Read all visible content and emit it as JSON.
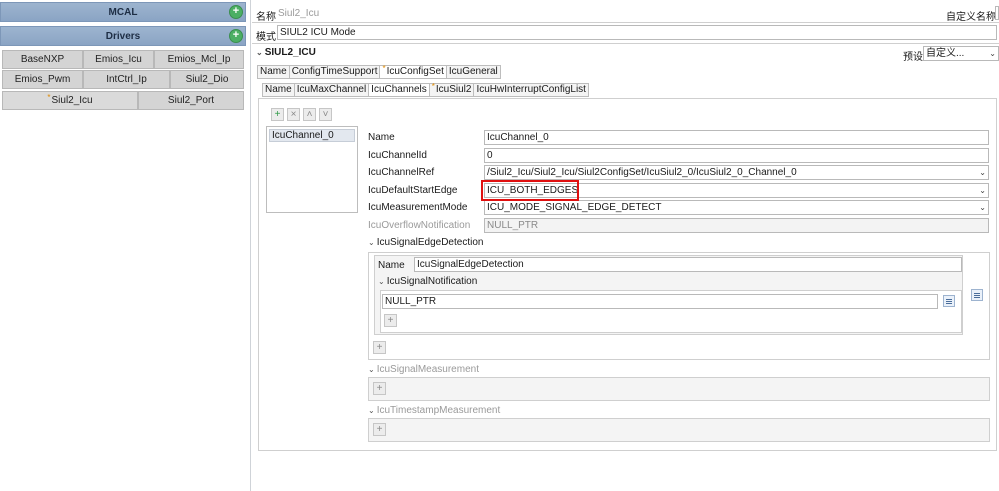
{
  "left": {
    "sections": [
      {
        "title": "MCAL"
      },
      {
        "title": "Drivers"
      }
    ],
    "drivers": [
      {
        "label": "BaseNXP"
      },
      {
        "label": "Emios_Icu"
      },
      {
        "label": "Emios_Mcl_Ip"
      },
      {
        "label": "Emios_Pwm"
      },
      {
        "label": "IntCtrl_Ip"
      },
      {
        "label": "Siul2_Dio"
      },
      {
        "label": "Siul2_Icu"
      },
      {
        "label": "Siul2_Port"
      }
    ]
  },
  "header": {
    "name_label": "名称",
    "name_value": "Siul2_Icu",
    "custom_name_label": "自定义名称",
    "mode_label": "模式",
    "mode_value": "SIUL2 ICU Mode",
    "section_title": "SIUL2_ICU",
    "preset_label": "预设",
    "preset_value": "自定义..."
  },
  "tabs_top": [
    "Name",
    "ConfigTimeSupport",
    "IcuConfigSet",
    "IcuGeneral"
  ],
  "tabs_second": [
    "Name",
    "IcuMaxChannel",
    "IcuChannels",
    "IcuSiul2",
    "IcuHwInterruptConfigList"
  ],
  "channels": [
    {
      "label": "IcuChannel_0"
    }
  ],
  "props": [
    {
      "label": "Name",
      "value": "IcuChannel_0"
    },
    {
      "label": "IcuChannelId",
      "value": "0"
    },
    {
      "label": "IcuChannelRef",
      "value": "/Siul2_Icu/Siul2_Icu/Siul2ConfigSet/IcuSiul2_0/IcuSiul2_0_Channel_0"
    },
    {
      "label": "IcuDefaultStartEdge",
      "value": "ICU_BOTH_EDGES"
    },
    {
      "label": "IcuMeasurementMode",
      "value": "ICU_MODE_SIGNAL_EDGE_DETECT"
    },
    {
      "label": "IcuOverflowNotification",
      "value": "NULL_PTR"
    }
  ],
  "edge_detection": {
    "title": "IcuSignalEdgeDetection",
    "name_label": "Name",
    "name_value": "IcuSignalEdgeDetection",
    "notification_title": "IcuSignalNotification",
    "notification_value": "NULL_PTR"
  },
  "signal_measurement": {
    "title": "IcuSignalMeasurement"
  },
  "timestamp_measurement": {
    "title": "IcuTimestampMeasurement"
  },
  "icons": {
    "add": "plus-icon",
    "remove": "close-icon",
    "up": "arrow-up-icon",
    "down": "arrow-down-icon",
    "expand": "chevron-down-icon",
    "list": "list-icon"
  },
  "colors": {
    "section_header": "#8aa4c4",
    "highlight_box": "#e01010",
    "add_green": "#4caf64"
  }
}
